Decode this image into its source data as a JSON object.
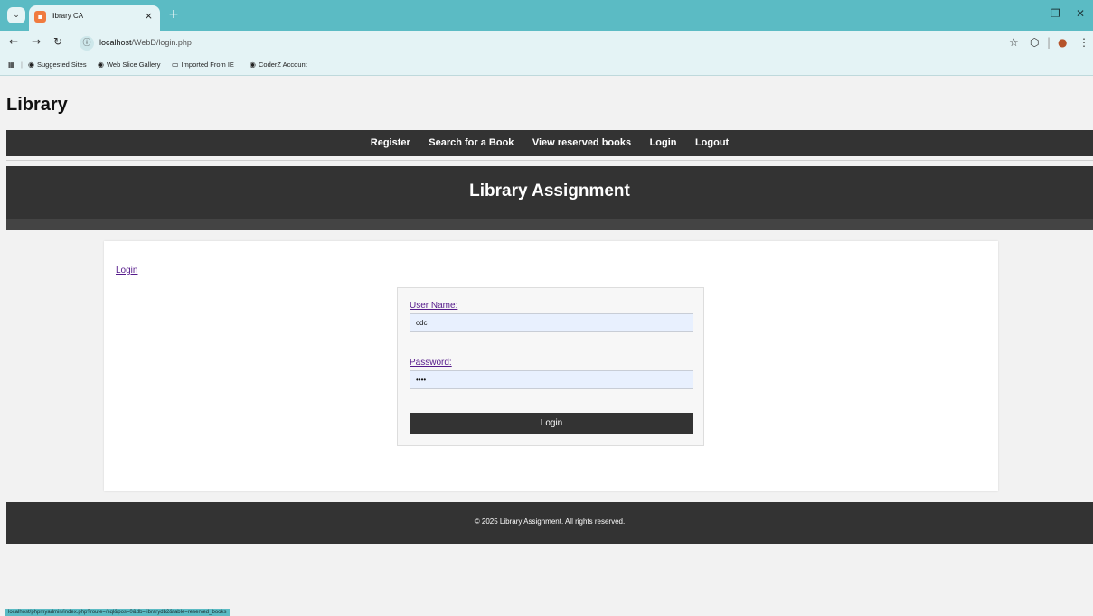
{
  "browser": {
    "tab_title": "library CA",
    "new_tab": "+",
    "tab_close": "×",
    "window_controls": {
      "minimize": "–",
      "restore": "❐",
      "close": "✕"
    },
    "url_host": "localhost",
    "url_path": "/WebD/login.php",
    "bookmarks": [
      {
        "label": "Suggested Sites",
        "icon": "globe-icon"
      },
      {
        "label": "Web Slice Gallery",
        "icon": "globe-icon"
      },
      {
        "label": "Imported From IE",
        "icon": "folder-icon"
      },
      {
        "label": "CoderZ Account",
        "icon": "globe-icon"
      }
    ],
    "status_url": "localhost/phpmyadmin/index.php?route=/sql&pos=0&db=librarydb2&table=reserved_books"
  },
  "site": {
    "title": "Library",
    "nav": [
      "Register",
      "Search for a Book",
      "View reserved books",
      "Login",
      "Logout"
    ],
    "banner_title": "Library Assignment",
    "footer": "© 2025 Library Assignment. All rights reserved."
  },
  "login": {
    "heading_link": "Login",
    "username_label": "User Name:",
    "username_value": "cdc",
    "password_label": "Password:",
    "password_value": "••••",
    "submit_label": "Login"
  },
  "colors": {
    "browser_accent": "#5bbbc4",
    "dark_bar": "#333333",
    "link": "#551a8b",
    "input_bg": "#e8f0fe"
  }
}
